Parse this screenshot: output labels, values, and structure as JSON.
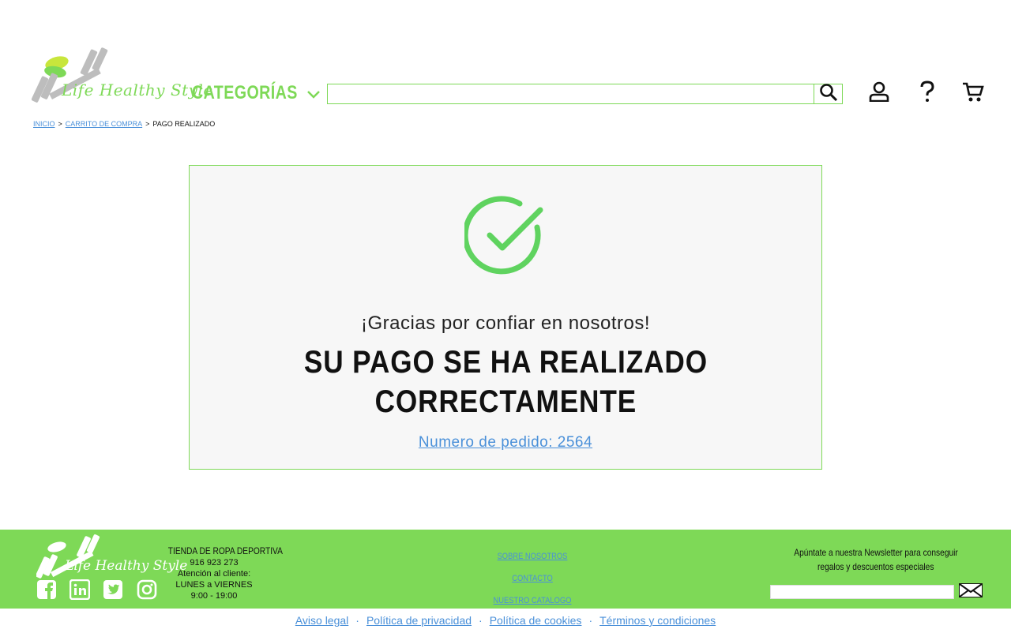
{
  "colors": {
    "brand_green": "#7ed957",
    "link_blue": "#4a90d9",
    "text": "#111111"
  },
  "header": {
    "logo_text": "Life Healthy Style",
    "categories_label": "CATEGORÍAS",
    "search_placeholder": "",
    "icons": [
      "search-icon",
      "user-icon",
      "help-icon",
      "cart-icon"
    ]
  },
  "breadcrumb": {
    "items": [
      {
        "label": "INICIO",
        "link": true
      },
      {
        "label": "CARRITO DE COMPRA",
        "link": true
      },
      {
        "label": "PAGO REALIZADO",
        "link": false
      }
    ],
    "separator": ">"
  },
  "confirmation": {
    "thanks": "¡Gracias por confiar en nosotros!",
    "headline_line1": "SU PAGO SE HA REALIZADO",
    "headline_line2": "CORRECTAMENTE",
    "order_label": "Numero de pedido: 2564"
  },
  "footer": {
    "logo_text": "Life Healthy Style",
    "store_title": "TIENDA DE ROPA DEPORTIVA",
    "phone": "916 923 273",
    "attention": "Atención al cliente:",
    "days": "LUNES a VIERNES",
    "hours": "9:00 - 19:00",
    "links": [
      "SOBRE NOSOTROS",
      "CONTACTO",
      "NUESTRO CATALOGO"
    ],
    "newsletter_line1": "Apúntate a nuestra Newsletter para conseguir",
    "newsletter_line2": "regalos y descuentos especiales",
    "newsletter_placeholder": "",
    "social": [
      "facebook-icon",
      "linkedin-icon",
      "twitter-icon",
      "instagram-icon"
    ]
  },
  "legal": {
    "links": [
      "Aviso legal",
      "Política de privacidad",
      "Política de cookies",
      "Términos y condiciones"
    ],
    "separator": "·"
  }
}
